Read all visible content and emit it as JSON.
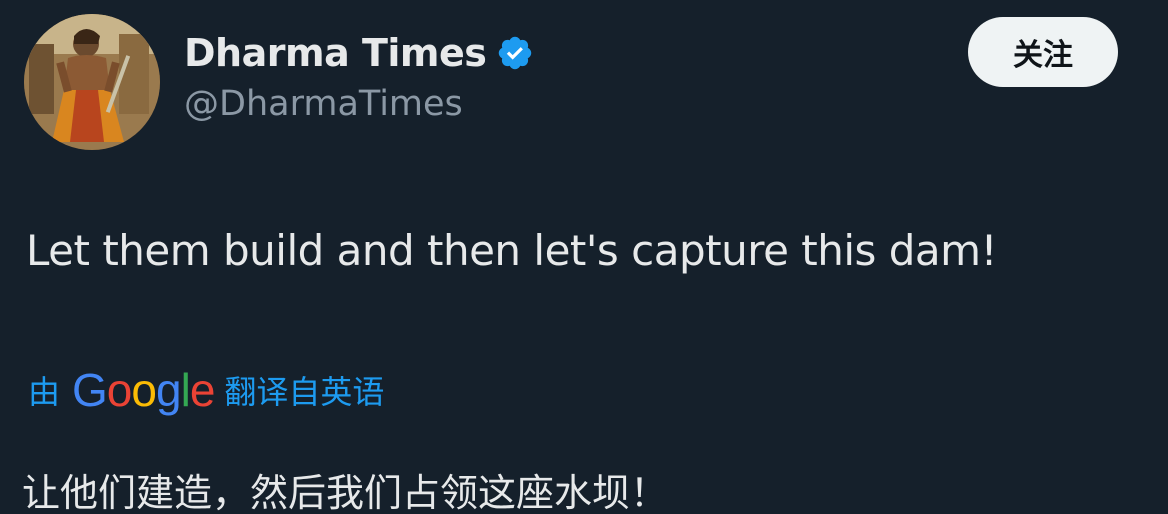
{
  "profile": {
    "display_name": "Dharma Times",
    "handle": "@DharmaTimes",
    "verified": true,
    "avatar_icon": "avatar-warrior-illustration"
  },
  "follow_button": {
    "label": "关注"
  },
  "tweet": {
    "text": "Let them build and then let's capture this dam!"
  },
  "translation": {
    "prefix": "由",
    "provider": "Google",
    "suffix": "翻译自英语",
    "text": "让他们建造，然后我们占领这座水坝！"
  },
  "colors": {
    "background": "#15202b",
    "accent": "#1d9bf0",
    "primary_text": "#e7e9ea",
    "secondary_text": "#8b98a5",
    "button_bg": "#eff3f4"
  }
}
